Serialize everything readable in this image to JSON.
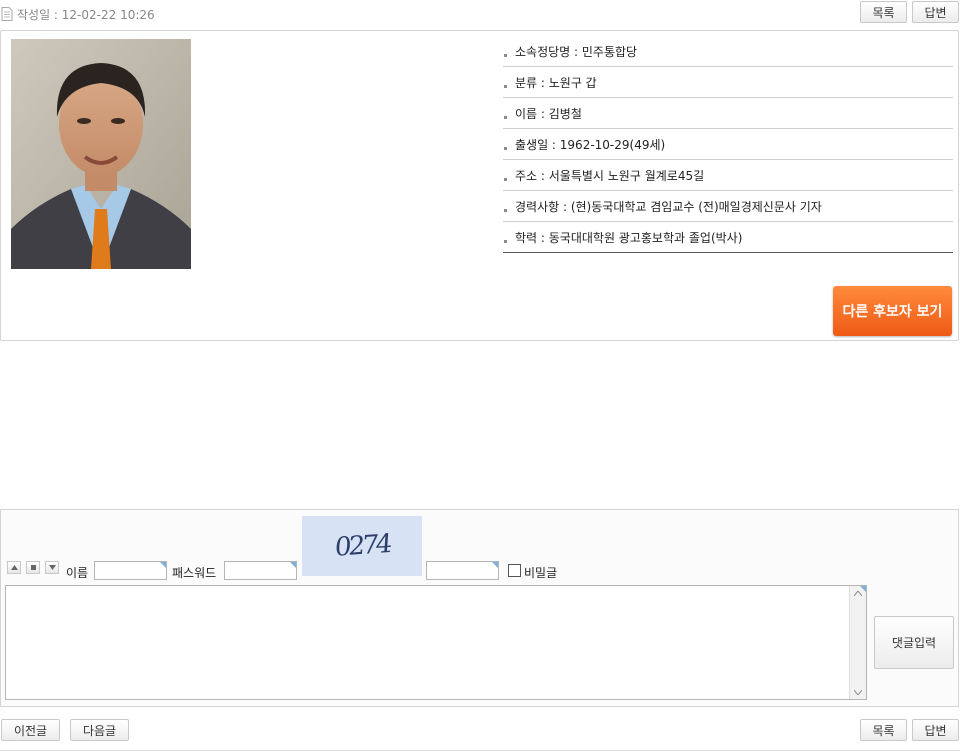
{
  "header": {
    "date_label": "작성일 : 12-02-22 10:26",
    "list_button": "목록",
    "reply_button": "답변"
  },
  "profile": {
    "rows": [
      {
        "label": "소속정당명 : 민주통합당"
      },
      {
        "label": "분류 : 노원구 갑"
      },
      {
        "label": "이름 : 김병철"
      },
      {
        "label": "출생일 : 1962-10-29(49세)"
      },
      {
        "label": "주소 : 서울특별시 노원구 월계로45길"
      },
      {
        "label": "경력사항 : (현)동국대학교 겸임교수 (전)매일경제신문사 기자"
      },
      {
        "label": "학력 : 동국대대학원 광고홍보학과 졸업(박사)"
      }
    ],
    "other_candidates_button": "다른 후보자 보기",
    "colors": {
      "accent_orange": "#f26522"
    }
  },
  "comment_form": {
    "name_label": "이름",
    "password_label": "패스워드",
    "captcha_text": "0274",
    "secret_label": "비밀글",
    "submit_button": "댓글입력"
  },
  "footer": {
    "prev_button": "이전글",
    "next_button": "다음글",
    "list_button": "목록",
    "reply_button": "답변"
  }
}
